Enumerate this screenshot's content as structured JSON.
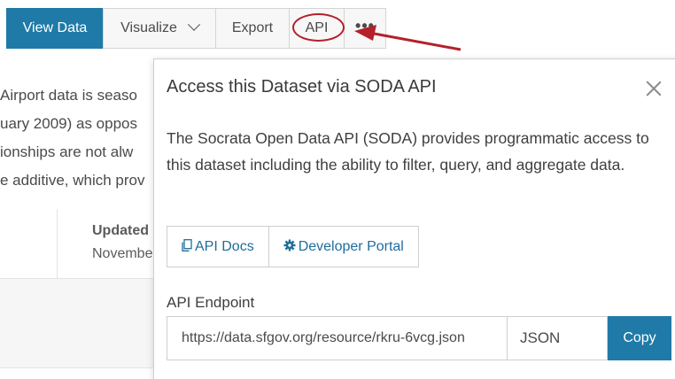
{
  "toolbar": {
    "view_data": "View Data",
    "visualize": "Visualize",
    "export": "Export",
    "api": "API",
    "more": "•••"
  },
  "background": {
    "lines": [
      "Airport data is seaso",
      "uary 2009) as oppos",
      "ionships are not alw",
      "e additive, which prov"
    ],
    "updated_label": "Updated",
    "updated_value": "Novembe"
  },
  "modal": {
    "title": "Access this Dataset via SODA API",
    "description": "The Socrata Open Data API (SODA) provides programmatic access to this dataset including the ability to filter, query, and aggregate data.",
    "api_docs_label": "API Docs",
    "developer_portal_label": "Developer Portal",
    "endpoint_label": "API Endpoint",
    "endpoint_url": "https://data.sfgov.org/resource/rkru-6vcg.json",
    "format": "JSON",
    "copy_label": "Copy"
  },
  "colors": {
    "primary": "#1f7aa8",
    "link": "#1f6d9b",
    "annotation": "#b5202a"
  },
  "icons": [
    "chevron-down-icon",
    "more-icon",
    "close-icon",
    "document-icon",
    "gear-icon",
    "arrow-annotation"
  ]
}
